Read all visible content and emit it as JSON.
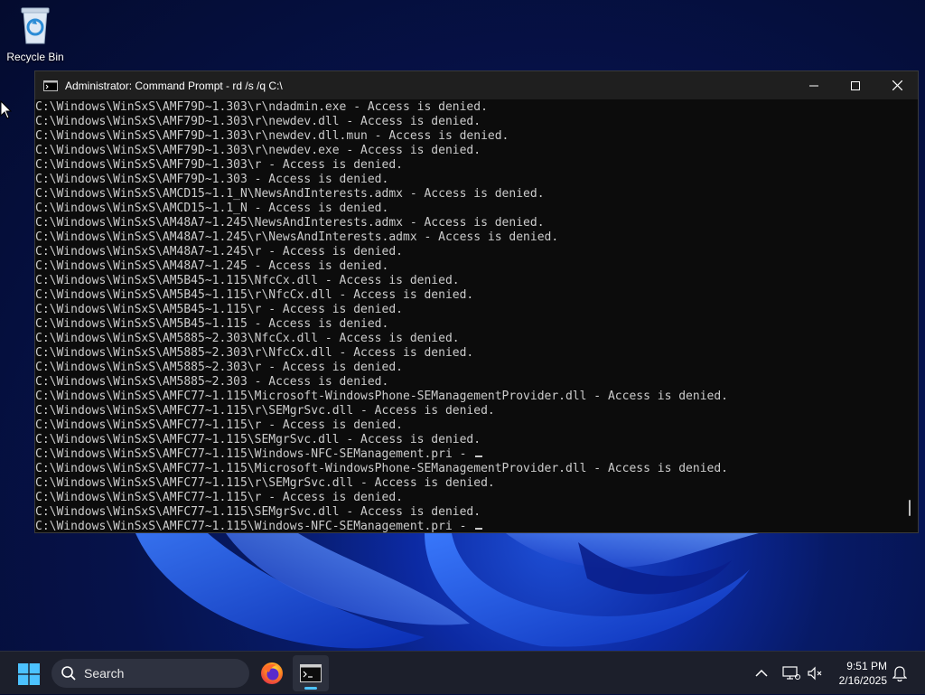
{
  "desktop": {
    "recycle_bin_label": "Recycle Bin"
  },
  "window": {
    "title": "Administrator: Command Prompt - rd  /s /q C:\\",
    "icon": "cmd-icon",
    "controls": [
      "minimize-icon",
      "maximize-icon",
      "close-icon"
    ]
  },
  "console": {
    "lines": [
      "C:\\Windows\\WinSxS\\AMF79D~1.303\\r\\ndadmin.exe - Access is denied.",
      "C:\\Windows\\WinSxS\\AMF79D~1.303\\r\\newdev.dll - Access is denied.",
      "C:\\Windows\\WinSxS\\AMF79D~1.303\\r\\newdev.dll.mun - Access is denied.",
      "C:\\Windows\\WinSxS\\AMF79D~1.303\\r\\newdev.exe - Access is denied.",
      "C:\\Windows\\WinSxS\\AMF79D~1.303\\r - Access is denied.",
      "C:\\Windows\\WinSxS\\AMF79D~1.303 - Access is denied.",
      "C:\\Windows\\WinSxS\\AMCD15~1.1_N\\NewsAndInterests.admx - Access is denied.",
      "C:\\Windows\\WinSxS\\AMCD15~1.1_N - Access is denied.",
      "C:\\Windows\\WinSxS\\AM48A7~1.245\\NewsAndInterests.admx - Access is denied.",
      "C:\\Windows\\WinSxS\\AM48A7~1.245\\r\\NewsAndInterests.admx - Access is denied.",
      "C:\\Windows\\WinSxS\\AM48A7~1.245\\r - Access is denied.",
      "C:\\Windows\\WinSxS\\AM48A7~1.245 - Access is denied.",
      "C:\\Windows\\WinSxS\\AM5B45~1.115\\NfcCx.dll - Access is denied.",
      "C:\\Windows\\WinSxS\\AM5B45~1.115\\r\\NfcCx.dll - Access is denied.",
      "C:\\Windows\\WinSxS\\AM5B45~1.115\\r - Access is denied.",
      "C:\\Windows\\WinSxS\\AM5B45~1.115 - Access is denied.",
      "C:\\Windows\\WinSxS\\AM5885~2.303\\NfcCx.dll - Access is denied.",
      "C:\\Windows\\WinSxS\\AM5885~2.303\\r\\NfcCx.dll - Access is denied.",
      "C:\\Windows\\WinSxS\\AM5885~2.303\\r - Access is denied.",
      "C:\\Windows\\WinSxS\\AM5885~2.303 - Access is denied.",
      "C:\\Windows\\WinSxS\\AMFC77~1.115\\Microsoft-WindowsPhone-SEManagementProvider.dll - Access is denied.",
      "C:\\Windows\\WinSxS\\AMFC77~1.115\\r\\SEMgrSvc.dll - Access is denied.",
      "C:\\Windows\\WinSxS\\AMFC77~1.115\\r - Access is denied.",
      "C:\\Windows\\WinSxS\\AMFC77~1.115\\SEMgrSvc.dll - Access is denied.",
      "C:\\Windows\\WinSxS\\AMFC77~1.115\\Windows-NFC-SEManagement.pri - ",
      "C:\\Windows\\WinSxS\\AMFC77~1.115\\Microsoft-WindowsPhone-SEManagementProvider.dll - Access is denied.",
      "C:\\Windows\\WinSxS\\AMFC77~1.115\\r\\SEMgrSvc.dll - Access is denied.",
      "C:\\Windows\\WinSxS\\AMFC77~1.115\\r - Access is denied.",
      "C:\\Windows\\WinSxS\\AMFC77~1.115\\SEMgrSvc.dll - Access is denied.",
      "C:\\Windows\\WinSxS\\AMFC77~1.115\\Windows-NFC-SEManagement.pri - "
    ],
    "caret_after_lines": [
      24,
      29
    ]
  },
  "taskbar": {
    "search_placeholder": "Search",
    "apps": [
      "start-icon",
      "firefox-icon",
      "terminal-icon"
    ],
    "tray_icons": [
      "chevron-up-icon",
      "network-icon",
      "volume-muted-icon",
      "notification-bell-icon"
    ],
    "time": "9:51 PM",
    "date": "2/16/2025",
    "accent": "#4cc2ff"
  }
}
